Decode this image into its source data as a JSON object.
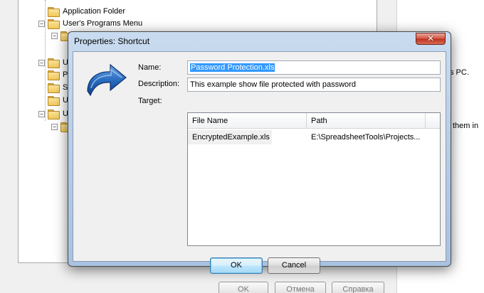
{
  "background": {
    "tree": {
      "items": [
        {
          "label": "Application Folder"
        },
        {
          "label": "User's Programs Menu"
        },
        {
          "label": ""
        },
        {
          "label": "U"
        },
        {
          "label": "P"
        },
        {
          "label": "S"
        },
        {
          "label": "U"
        },
        {
          "label": "U"
        }
      ]
    },
    "right_panel": {
      "line1": "s PC.",
      "line2": "them in"
    },
    "buttons": {
      "ok": "OK",
      "cancel": "Отмена",
      "help": "Справка"
    }
  },
  "dialog": {
    "title": "Properties: Shortcut",
    "close_label": "✕",
    "icon": "shortcut-arrow-icon",
    "name_label": "Name:",
    "name_value": "Password Protection.xls",
    "description_label": "Description:",
    "description_value": "This example show file protected with password",
    "target_label": "Target:",
    "target_list": {
      "columns": [
        "File Name",
        "Path"
      ],
      "rows": [
        [
          "EncryptedExample.xls",
          "E:\\SpreadsheetTools\\Projects..."
        ]
      ]
    },
    "ok_label": "OK",
    "cancel_label": "Cancel"
  },
  "colors": {
    "accent": "#3399ff",
    "dialog_frame": "#b3cae6",
    "close_button": "#c9442e",
    "icon_blue": "#1e5fb0"
  }
}
